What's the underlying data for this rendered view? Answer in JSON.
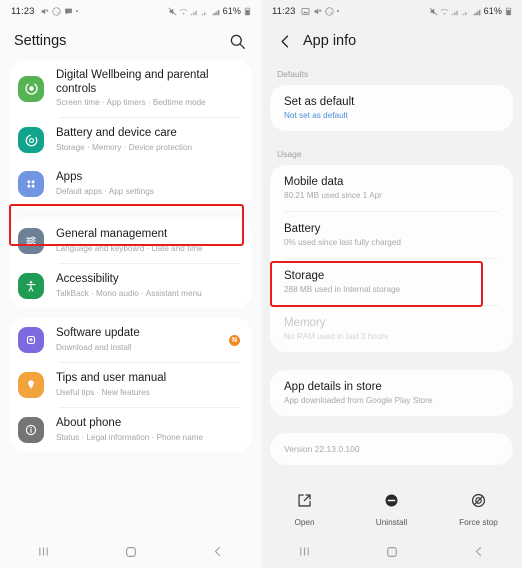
{
  "status_bar": {
    "time": "11:23",
    "battery": "61%",
    "left_icons_right": [
      "image-icon",
      "sound-mode-icon",
      "whatsapp-icon",
      "messages-icon",
      "more-dot-icon"
    ],
    "right_icons": [
      "mute-icon",
      "wifi-calling-icon",
      "signal-icon",
      "signal-2-icon",
      "signal-bars-icon",
      "battery-icon"
    ]
  },
  "left_screen": {
    "title": "Settings",
    "search_icon": "search-icon",
    "groups": [
      {
        "items": [
          {
            "title": "Digital Wellbeing and parental controls",
            "subtitle": "Screen time  ·  App timers  ·  Bedtime mode",
            "icon": "digital-wellbeing-icon",
            "color": "#55b353"
          },
          {
            "title": "Battery and device care",
            "subtitle": "Storage  ·  Memory  ·  Device protection",
            "icon": "battery-care-icon",
            "color": "#12a38c"
          },
          {
            "title": "Apps",
            "subtitle": "Default apps  ·  App settings",
            "icon": "apps-grid-icon",
            "color": "#7196e3",
            "highlighted": true
          }
        ]
      },
      {
        "items": [
          {
            "title": "General management",
            "subtitle": "Language and keyboard  ·  Date and time",
            "icon": "general-management-icon",
            "color": "#6c8196"
          },
          {
            "title": "Accessibility",
            "subtitle": "TalkBack  ·  Mono audio  ·  Assistant menu",
            "icon": "accessibility-icon",
            "color": "#1f9d55"
          }
        ]
      },
      {
        "items": [
          {
            "title": "Software update",
            "subtitle": "Download and install",
            "icon": "software-update-icon",
            "color": "#7b6ae0",
            "badge": "N"
          },
          {
            "title": "Tips and user manual",
            "subtitle": "Useful tips  ·  New features",
            "icon": "tips-bulb-icon",
            "color": "#f2a33c"
          },
          {
            "title": "About phone",
            "subtitle": "Status  ·  Legal information  ·  Phone name",
            "icon": "about-phone-icon",
            "color": "#757575"
          }
        ]
      }
    ]
  },
  "right_screen": {
    "title": "App info",
    "back_icon": "chevron-left-icon",
    "sections": [
      {
        "label": "Defaults",
        "rows": [
          {
            "title": "Set as default",
            "subtitle": "Not set as default",
            "subtitle_style": "link"
          }
        ]
      },
      {
        "label": "Usage",
        "rows": [
          {
            "title": "Mobile data",
            "subtitle": "80.21 MB used since 1 Apr"
          },
          {
            "title": "Battery",
            "subtitle": "0% used since last fully charged"
          },
          {
            "title": "Storage",
            "subtitle": "288 MB used in Internal storage",
            "highlighted": true
          },
          {
            "title": "Memory",
            "subtitle": "No RAM used in last 3 hours",
            "disabled": true
          }
        ]
      },
      {
        "label": "",
        "rows": [
          {
            "title": "App details in store",
            "subtitle": "App downloaded from Google Play Store"
          }
        ]
      }
    ],
    "version": "Version 22.13.0.100",
    "actions": [
      {
        "label": "Open",
        "icon": "open-external-icon"
      },
      {
        "label": "Uninstall",
        "icon": "uninstall-minus-circle-icon"
      },
      {
        "label": "Force stop",
        "icon": "force-stop-icon"
      }
    ]
  },
  "nav_bar": {
    "recents": "recents-icon",
    "home": "home-icon",
    "back": "back-icon"
  },
  "colors": {
    "highlight": "#e81d1d",
    "link": "#4a8fd4",
    "badge": "#f08a24"
  }
}
